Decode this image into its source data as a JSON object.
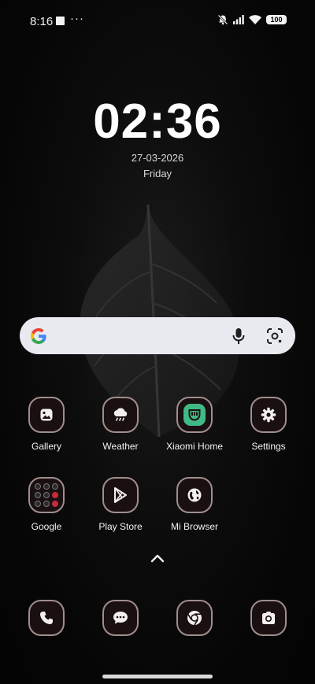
{
  "status_bar": {
    "time": "8:16",
    "battery": "100"
  },
  "clock": {
    "time": "02:36",
    "date": "27-03-2026",
    "weekday": "Friday"
  },
  "search_bar": {
    "logo_icon": "google-g-icon",
    "mic_icon": "microphone-icon",
    "lens_icon": "google-lens-icon"
  },
  "apps_row1": [
    {
      "label": "Gallery",
      "icon": "gallery-icon"
    },
    {
      "label": "Weather",
      "icon": "weather-cloud-icon"
    },
    {
      "label": "Xiaomi Home",
      "icon": "xiaomi-home-icon"
    },
    {
      "label": "Settings",
      "icon": "gear-icon"
    }
  ],
  "apps_row2": [
    {
      "label": "Google",
      "icon": "google-folder-icon"
    },
    {
      "label": "Play Store",
      "icon": "play-store-icon"
    },
    {
      "label": "Mi Browser",
      "icon": "globe-icon"
    }
  ],
  "dock": [
    {
      "icon": "phone-icon"
    },
    {
      "icon": "messages-icon"
    },
    {
      "icon": "chrome-icon"
    },
    {
      "icon": "camera-icon"
    }
  ],
  "colors": {
    "icon_border": "#a08e8d",
    "icon_fill": "#1a1011",
    "xiaomi_green": "#3fba85",
    "search_bg": "#e8eaef"
  }
}
